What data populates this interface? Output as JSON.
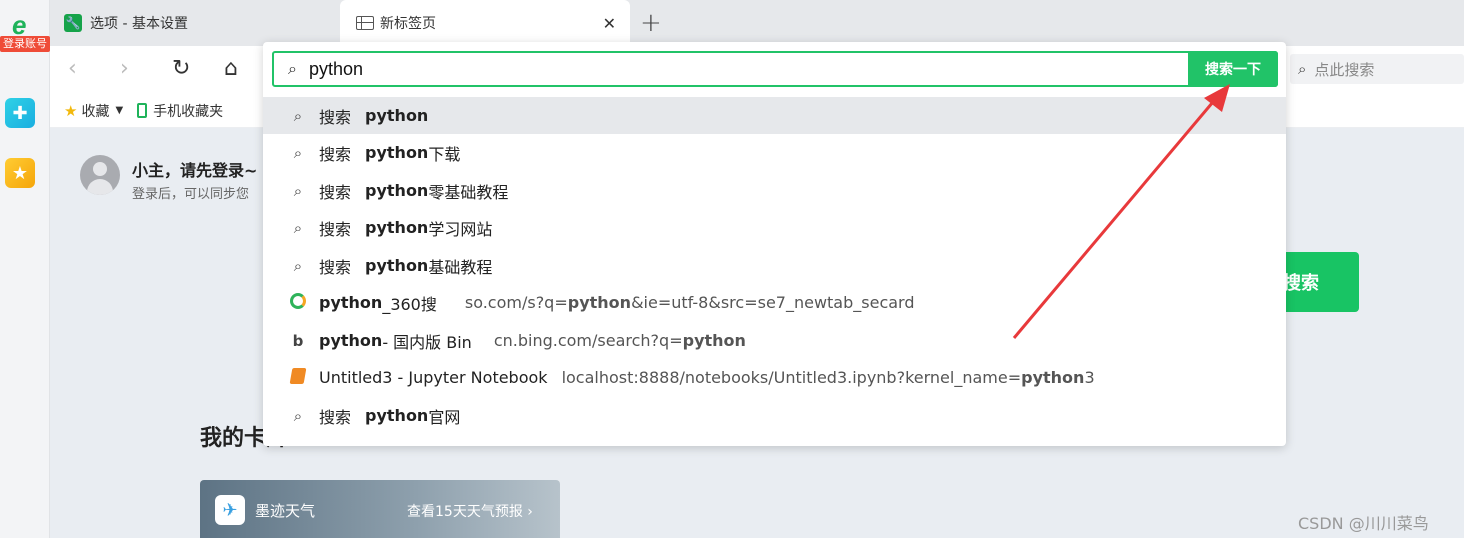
{
  "rail": {
    "account_label": "登录账号"
  },
  "tabs": [
    {
      "title": "选项 - 基本设置"
    },
    {
      "title": "新标签页"
    }
  ],
  "toolbar": {
    "search_placeholder": "点此搜索"
  },
  "bookmarks": {
    "favorites": "收藏",
    "mobile": "手机收藏夹"
  },
  "page": {
    "login_title": "小主，请先登录~",
    "login_sub": "登录后，可以同步您",
    "search_button": "搜索",
    "my_cards": "我的卡片",
    "weather_title": "墨迹天气",
    "weather_link": "查看15天天气预报 ›"
  },
  "omnibox": {
    "value": "python",
    "search_button": "搜索一下",
    "verb": "搜索",
    "suggestions": [
      {
        "bold": "python",
        "rest": ""
      },
      {
        "bold": "python",
        "rest": "下载"
      },
      {
        "bold": "python",
        "rest": "零基础教程"
      },
      {
        "bold": "python",
        "rest": "学习网站"
      },
      {
        "bold": "python",
        "rest": "基础教程"
      }
    ],
    "history": [
      {
        "title_bold": "python",
        "title_rest": "_360搜",
        "url_pre": "so.com/s?q=",
        "url_bold": "python",
        "url_post": "&ie=utf-8&src=se7_newtab_secard"
      },
      {
        "title_bold": "python",
        "title_rest": " - 国内版 Bin",
        "url_pre": "cn.bing.com/search?q=",
        "url_bold": "python",
        "url_post": ""
      },
      {
        "title_bold": "",
        "title_rest": "Untitled3 - Jupyter Notebook",
        "url_pre": "localhost:8888/notebooks/Untitled3.ipynb?kernel_name=",
        "url_bold": "python",
        "url_post": "3"
      }
    ],
    "last": {
      "bold": "python",
      "rest": "官网"
    }
  },
  "watermark": "CSDN @川川菜鸟"
}
